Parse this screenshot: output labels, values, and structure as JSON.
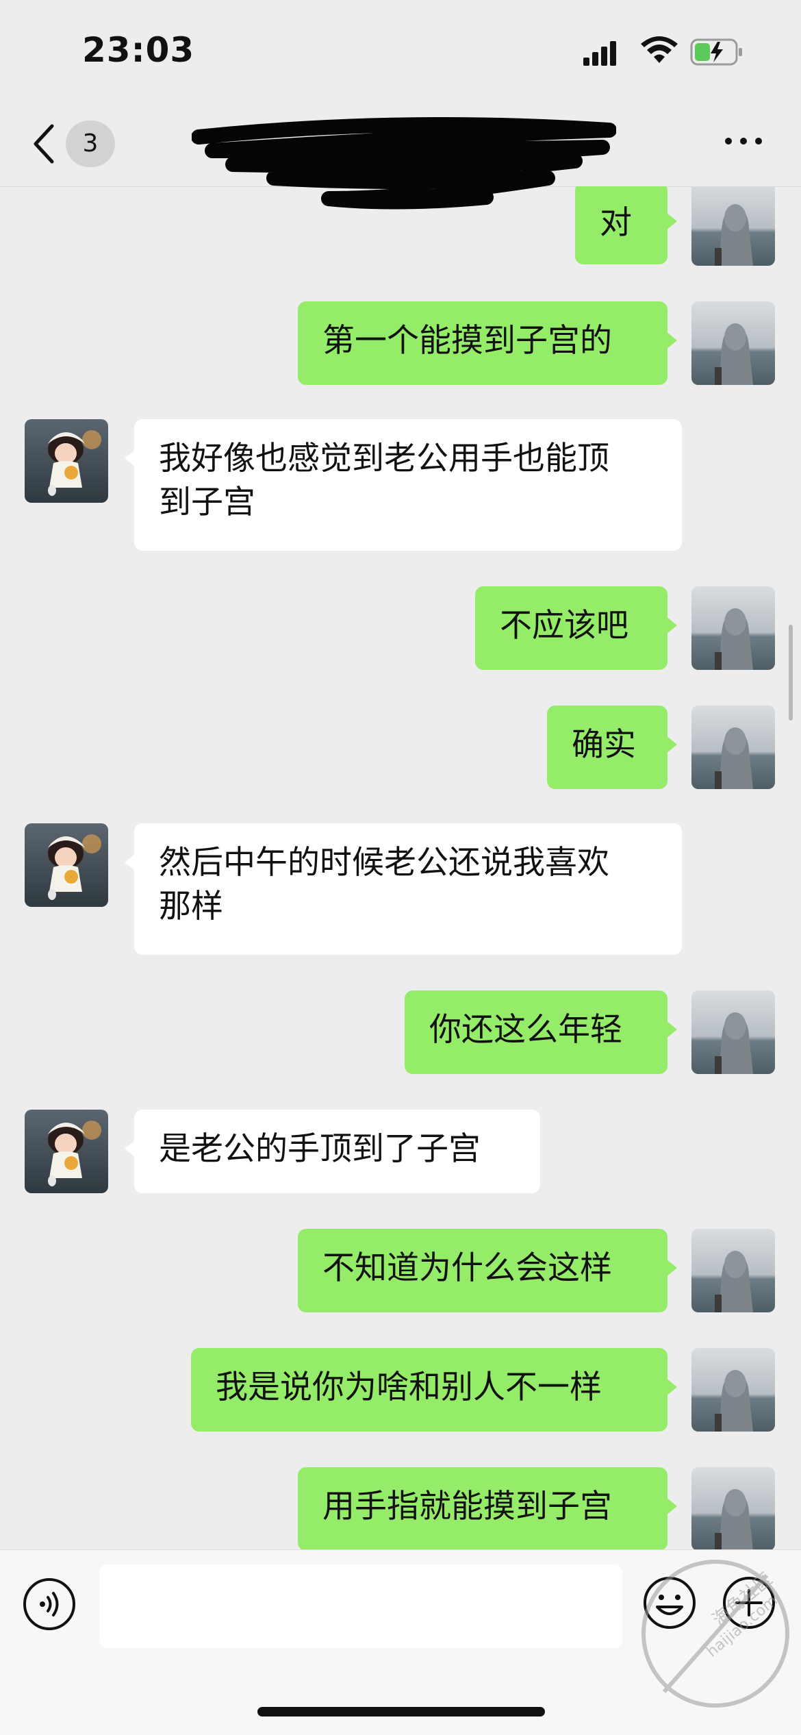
{
  "status_bar": {
    "time": "23:03"
  },
  "header": {
    "unread_count": "3"
  },
  "messages": [
    {
      "side": "sent",
      "text": "对"
    },
    {
      "side": "sent",
      "text": "第一个能摸到子宫的"
    },
    {
      "side": "received",
      "line1": "我好像也感觉到老公用手也能顶",
      "line2": "到子宫"
    },
    {
      "side": "sent",
      "text": "不应该吧"
    },
    {
      "side": "sent",
      "text": "确实"
    },
    {
      "side": "received",
      "line1": "然后中午的时候老公还说我喜欢",
      "line2": "那样"
    },
    {
      "side": "sent",
      "text": "你还这么年轻"
    },
    {
      "side": "received",
      "text": "是老公的手顶到了子宫"
    },
    {
      "side": "sent",
      "text": "不知道为什么会这样"
    },
    {
      "side": "sent",
      "text": "我是说你为啥和别人不一样"
    },
    {
      "side": "sent",
      "text": "用手指就能摸到子宫"
    }
  ],
  "input_bar": {
    "placeholder": ""
  },
  "watermark": {
    "line1": "海角社区",
    "line2": "haijiao.com"
  },
  "colors": {
    "background": "#ededed",
    "sent_bubble": "#95ec69",
    "received_bubble": "#ffffff",
    "input_bar": "#f7f7f7"
  },
  "icons": [
    "signal-icon",
    "wifi-icon",
    "battery-charging-icon",
    "back-chevron-icon",
    "more-icon",
    "voice-icon",
    "emoji-icon",
    "plus-icon"
  ]
}
